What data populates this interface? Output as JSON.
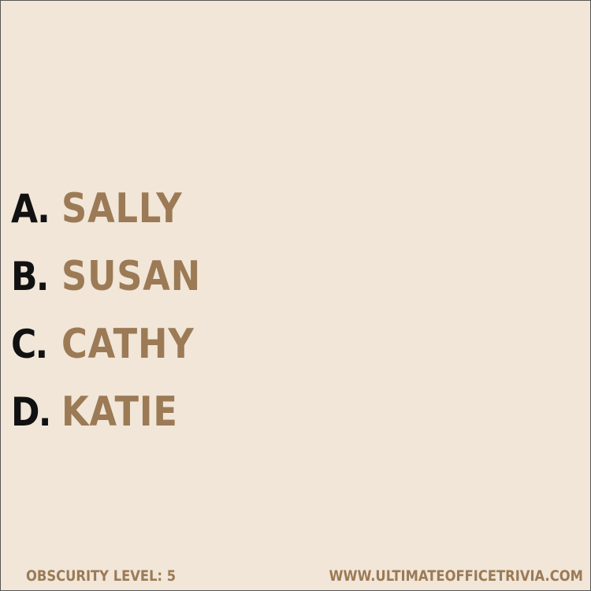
{
  "options": [
    {
      "letter": "A.",
      "answer": "SALLY"
    },
    {
      "letter": "B.",
      "answer": "SUSAN"
    },
    {
      "letter": "C.",
      "answer": "CATHY"
    },
    {
      "letter": "D.",
      "answer": "KATIE"
    }
  ],
  "footer": {
    "obscurity": "OBSCURITY LEVEL: 5",
    "website": "WWW.ULTIMATEOFFICETRIVIA.COM"
  },
  "colors": {
    "background": "#f1e6d8",
    "letter": "#111111",
    "accent": "#9b7a55"
  }
}
